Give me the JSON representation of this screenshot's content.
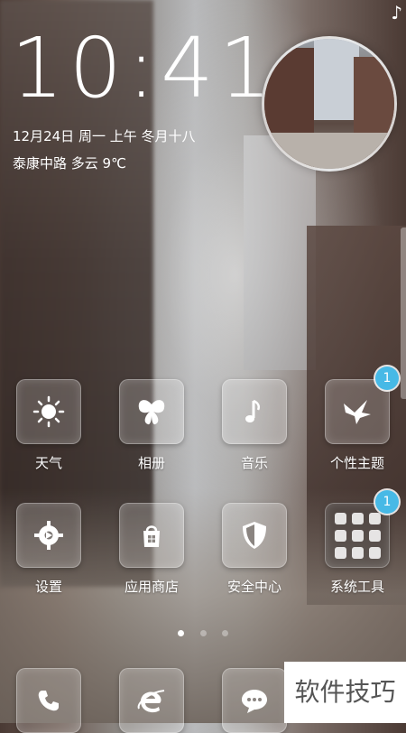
{
  "status": {
    "icon": "music-note-icon"
  },
  "lock": {
    "time": "10:41",
    "date_line": "12月24日 周一 上午 冬月十八",
    "weather_line": "泰康中路 多云 9℃"
  },
  "home": {
    "row1": [
      {
        "label": "天气",
        "icon": "sun-icon"
      },
      {
        "label": "相册",
        "icon": "butterfly-icon"
      },
      {
        "label": "音乐",
        "icon": "music-note-icon"
      },
      {
        "label": "个性主题",
        "icon": "bird-icon",
        "badge": "1"
      }
    ],
    "row2": [
      {
        "label": "设置",
        "icon": "gear-icon"
      },
      {
        "label": "应用商店",
        "icon": "store-bag-icon"
      },
      {
        "label": "安全中心",
        "icon": "shield-icon"
      },
      {
        "label": "系统工具",
        "icon": "folder-grid-icon",
        "badge": "1"
      }
    ],
    "dock": [
      {
        "icon": "phone-icon"
      },
      {
        "icon": "browser-e-icon"
      },
      {
        "icon": "message-bubble-icon"
      }
    ],
    "pager": {
      "count": 3,
      "active": 0
    }
  },
  "watermark": "软件技巧",
  "colors": {
    "badge": "#47b9e6",
    "pager_active": "#ffffff",
    "pager_inactive": "rgba(255,255,255,0.35)"
  }
}
